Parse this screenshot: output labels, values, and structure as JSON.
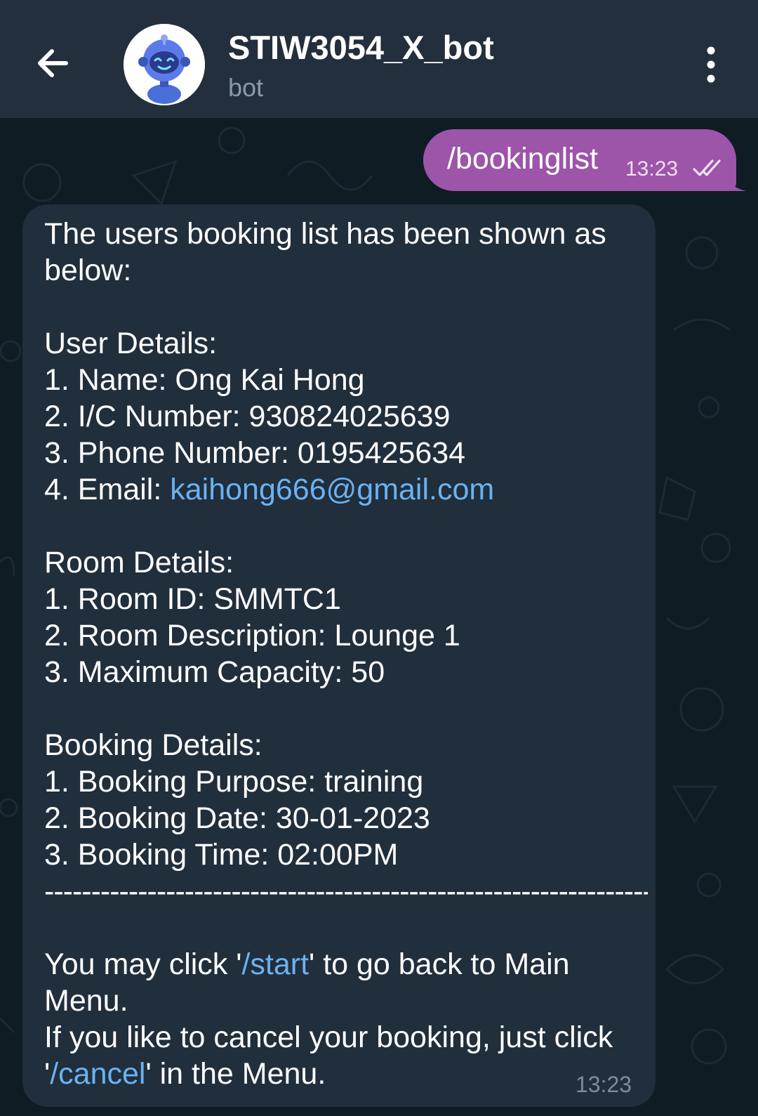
{
  "header": {
    "title": "STIW3054_X_bot",
    "subtitle": "bot",
    "back_icon": "arrow-left-icon",
    "menu_icon": "more-vertical-icon",
    "avatar_icon": "robot-avatar"
  },
  "outgoing": {
    "text": "/bookinglist",
    "time": "13:23",
    "status_icon": "double-check-icon"
  },
  "incoming": {
    "intro": "The users booking list has been shown as below:",
    "user_heading": "User Details:",
    "name": "1. Name: Ong Kai Hong",
    "ic": "2. I/C Number: 930824025639",
    "phone": "3. Phone Number: 0195425634",
    "email_prefix": "4. Email: ",
    "email": "kaihong666@gmail.com",
    "room_heading": "Room Details:",
    "room_id": "1. Room ID: SMMTC1",
    "room_desc": "2. Room Description: Lounge 1",
    "room_cap": "3. Maximum Capacity: 50",
    "booking_heading": "Booking Details:",
    "purpose": "1. Booking Purpose: training",
    "date": "2. Booking Date: 30-01-2023",
    "btime": "3. Booking Time: 02:00PM",
    "divider": "------------------------------------------------------------------",
    "click_prefix": "You may click '",
    "start_cmd": "/start",
    "click_suffix": "' to go back to Main Menu.",
    "cancel_prefix": "If you like to cancel your booking, just click '",
    "cancel_cmd": "/cancel",
    "cancel_suffix": "' in the Menu.",
    "time": "13:23"
  },
  "colors": {
    "header_bg": "#232f3c",
    "chat_bg": "#0f1c24",
    "outgoing_bubble": "#9c55a8",
    "incoming_bubble": "#212e3b",
    "link": "#6ab2f2"
  }
}
